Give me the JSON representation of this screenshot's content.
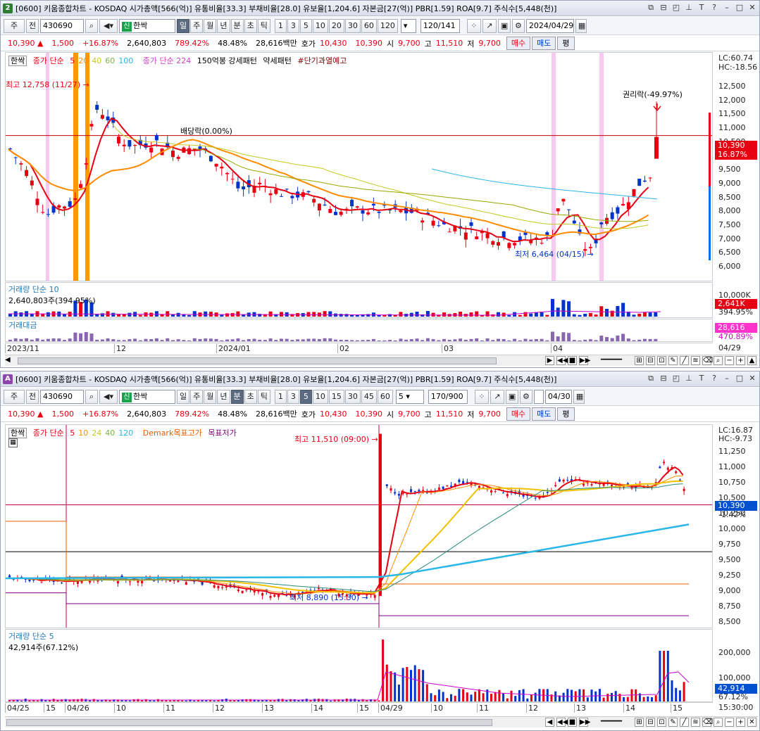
{
  "top": {
    "window_number": "2",
    "title": "[0600] 키움종합차트 - KOSDAQ 시가총액[566(억)] 유통비율[33.3] 부채비율[28.0] 유보율[1,204.6] 자본금[27(억)] PBR[1.59] ROA[9.7] 주식수[5,448(천)]",
    "toolbar": {
      "period": "주",
      "prev_label": "전",
      "code": "430690",
      "name": "한싹",
      "sin_badge": "신",
      "periods": [
        "일",
        "주",
        "월",
        "년",
        "분",
        "초",
        "틱"
      ],
      "active_period": "일",
      "nums": [
        "1",
        "3",
        "5",
        "10",
        "20",
        "30",
        "60",
        "120"
      ],
      "count": "120",
      "total": "/141",
      "date": "2024/04/29"
    },
    "quote": {
      "price": "10,390",
      "change": "1,500",
      "pct": "+16.87%",
      "volume": "2,640,803",
      "vol_ratio": "789.42%",
      "turnover": "48.48%",
      "amount": "28,616백만",
      "ask_label": "호가",
      "ask": "10,430",
      "bid": "10,390",
      "open_label": "시",
      "open": "9,700",
      "high_label": "고",
      "high": "11,510",
      "low_label": "저",
      "low": "9,700",
      "buy": "매수",
      "sell": "매도",
      "avg": "평"
    },
    "legend": {
      "stock": "한싹",
      "ma_label": "종가 단순",
      "ma_values": [
        "5",
        "20",
        "40",
        "60",
        "100"
      ],
      "ma224": "종가 단순 224",
      "pattern1": "150억봉 강세패턴",
      "pattern2": "약세패턴",
      "warn": "#단기과열예고"
    },
    "annotations": {
      "high": "최고 12,758 (11/27)",
      "div": "배당락(0.00%)",
      "rights": "권리락(-49.97%)",
      "low": "최저 6,464 (04/15)"
    },
    "yaxis": {
      "lc": "LC:60.74",
      "hc": "HC:-18.56",
      "labels": [
        "12,500",
        "12,000",
        "11,500",
        "11,000",
        "10,500",
        "10,000",
        "9,500",
        "9,000",
        "8,500",
        "8,000",
        "7,500",
        "7,000",
        "6,500",
        "6,000"
      ],
      "price_box": "10,390",
      "pct_box": "16.87%"
    },
    "volume_panel": {
      "title": "거래량 단순 10",
      "value": "2,640,803주(394.95%)",
      "scale": "10,000K",
      "box": "2,641K",
      "pct": "394.95%"
    },
    "amount_panel": {
      "title": "거래대금",
      "box": "28,616",
      "pct": "470.89%"
    },
    "xaxis": [
      "2023/11",
      "12",
      "2024/01",
      "02",
      "03",
      "04"
    ],
    "xend": "04/29"
  },
  "bottom": {
    "window_number": "A",
    "title": "[0600] 키움종합차트 - KOSDAQ 시가총액[566(억)] 유통비율[33.3] 부채비율[28.0] 유보율[1,204.6] 자본금[27(억)] PBR[1.59] ROA[9.7] 주식수[5,448(천)]",
    "toolbar": {
      "period": "주",
      "prev_label": "전",
      "code": "430690",
      "name": "한싹",
      "sin_badge": "신",
      "periods": [
        "일",
        "주",
        "월",
        "년",
        "분",
        "초",
        "틱"
      ],
      "active_period": "분",
      "nums": [
        "1",
        "3",
        "5",
        "10",
        "15",
        "30",
        "45",
        "60"
      ],
      "active_num": "5",
      "sel": "5",
      "count": "170",
      "total": "/900",
      "date": "04/30"
    },
    "quote": {
      "price": "10,390",
      "change": "1,500",
      "pct": "+16.87%",
      "volume": "2,640,803",
      "vol_ratio": "789.42%",
      "turnover": "48.48%",
      "amount": "28,616백만",
      "ask_label": "호가",
      "ask": "10,430",
      "bid": "10,390",
      "open_label": "시",
      "open": "9,700",
      "high_label": "고",
      "high": "11,510",
      "low_label": "저",
      "low": "9,700",
      "buy": "매수",
      "sell": "매도",
      "avg": "평"
    },
    "legend": {
      "stock": "한싹",
      "ma_label": "종가 단순",
      "ma_values": [
        "5",
        "10",
        "24",
        "40",
        "120"
      ],
      "demark_high": "Demark목표고가",
      "demark_low": "목표저가"
    },
    "annotations": {
      "high": "최고 11,510 (09:00)",
      "low": "최저 8,890 (15:30)"
    },
    "yaxis": {
      "lc": "LC:16.87",
      "hc": "HC:-9.73",
      "labels": [
        "11,250",
        "11,000",
        "10,750",
        "10,500",
        "10,250",
        "10,000",
        "9,750",
        "9,500",
        "9,250",
        "9,000",
        "8,750",
        "8,500"
      ],
      "price_box": "10,390",
      "pct_box": "-1.42%"
    },
    "volume_panel": {
      "title": "거래량 단순 5",
      "value": "42,914주(67.12%)",
      "scale1": "200,000",
      "scale2": "100,000",
      "box": "42,914",
      "pct": "67.12%"
    },
    "xaxis": [
      "04/25",
      "15",
      "04/26",
      "10",
      "11",
      "12",
      "13",
      "14",
      "15",
      "04/29",
      "10",
      "11",
      "12",
      "13",
      "14",
      "15"
    ],
    "xend": "15:30:00"
  },
  "colors": {
    "up": "#e60012",
    "down": "#0033cc",
    "ma5": "#e60012",
    "ma20": "#ff8c00",
    "ma_mid": "#c8c820",
    "ma_long": "#29b6e8",
    "highlight_orange": "#ff9900",
    "highlight_pink": "#f7c8f0"
  }
}
